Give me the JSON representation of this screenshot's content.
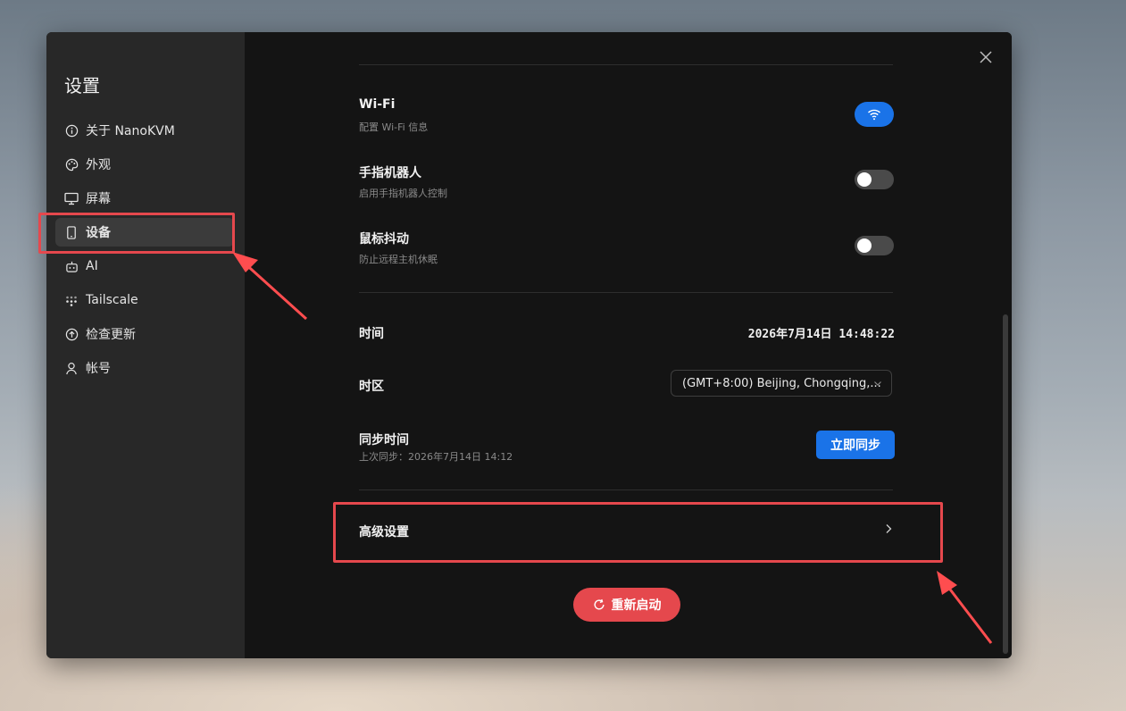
{
  "sidebar": {
    "title": "设置",
    "items": [
      {
        "label": "关于 NanoKVM",
        "icon": "info-icon"
      },
      {
        "label": "外观",
        "icon": "palette-icon"
      },
      {
        "label": "屏幕",
        "icon": "monitor-icon"
      },
      {
        "label": "设备",
        "icon": "device-icon",
        "active": true
      },
      {
        "label": "AI",
        "icon": "robot-icon"
      },
      {
        "label": "Tailscale",
        "icon": "tailscale-icon"
      },
      {
        "label": "检查更新",
        "icon": "upload-icon"
      },
      {
        "label": "帐号",
        "icon": "user-icon"
      }
    ]
  },
  "content": {
    "top_faint_text": "...",
    "wifi": {
      "title": "Wi-Fi",
      "subtitle": "配置 Wi-Fi 信息"
    },
    "finger_robot": {
      "title": "手指机器人",
      "subtitle": "启用手指机器人控制",
      "enabled": false
    },
    "mouse_jiggler": {
      "title": "鼠标抖动",
      "subtitle": "防止远程主机休眠",
      "enabled": false
    },
    "time": {
      "label": "时间",
      "value": "2026年7月14日 14:48:22"
    },
    "timezone": {
      "label": "时区",
      "value": "(GMT+8:00) Beijing, Chongqing,..."
    },
    "sync": {
      "title": "同步时间",
      "subtitle": "上次同步：2026年7月14日 14:12",
      "button": "立即同步"
    },
    "advanced": {
      "label": "高级设置"
    },
    "restart": {
      "label": "重新启动"
    }
  },
  "colors": {
    "accent_blue": "#1a73e8",
    "danger_red": "#e5484d",
    "annotation_red": "#e5484d"
  }
}
